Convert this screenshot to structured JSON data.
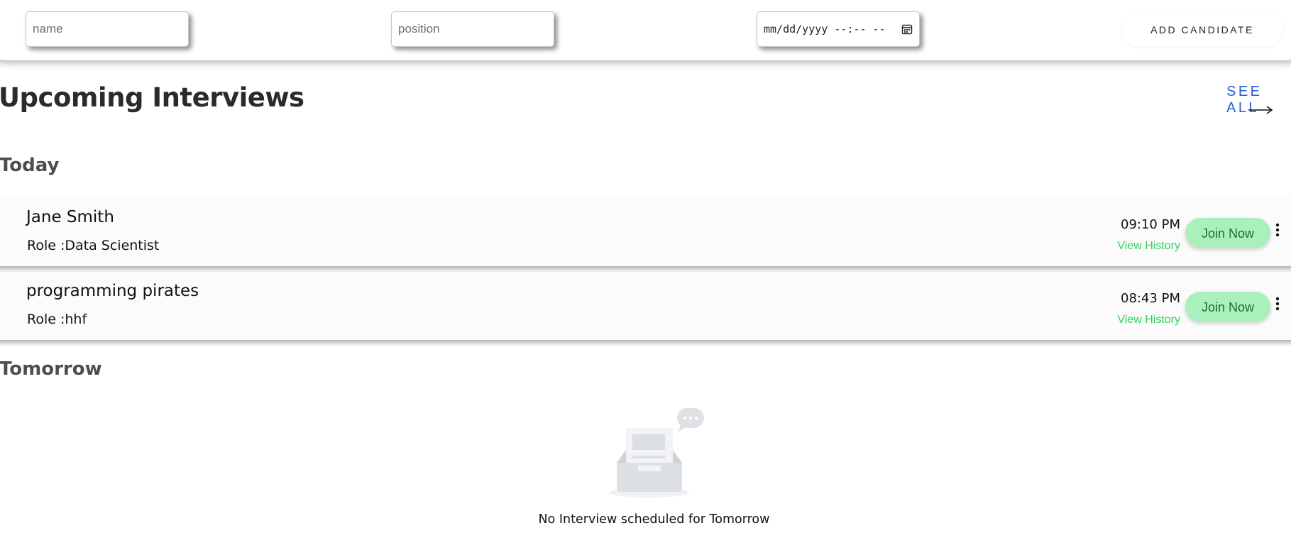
{
  "form": {
    "name_placeholder": "name",
    "position_placeholder": "position",
    "datetime_placeholder": "mm/dd/yyyy --:-- --",
    "add_button": "ADD CANDIDATE"
  },
  "header": {
    "title": "Upcoming Interviews",
    "see_all": "SEE ALL"
  },
  "sections": {
    "today": "Today",
    "tomorrow": "Tomorrow"
  },
  "interviews": [
    {
      "name": "Jane Smith",
      "role": "Role :Data Scientist",
      "time": "09:10 PM",
      "history_link": "View History",
      "join_label": "Join Now"
    },
    {
      "name": "programming pirates",
      "role": "Role :hhf",
      "time": "08:43 PM",
      "history_link": "View History",
      "join_label": "Join Now"
    }
  ],
  "tomorrow_empty": {
    "message": "No Interview scheduled for Tomorrow",
    "icon": "empty-inbox-icon"
  },
  "colors": {
    "link_blue": "#2c5bd6",
    "history_green": "#2fd15d",
    "join_bg": "#a9f0bd",
    "join_text": "#1f6b36"
  }
}
